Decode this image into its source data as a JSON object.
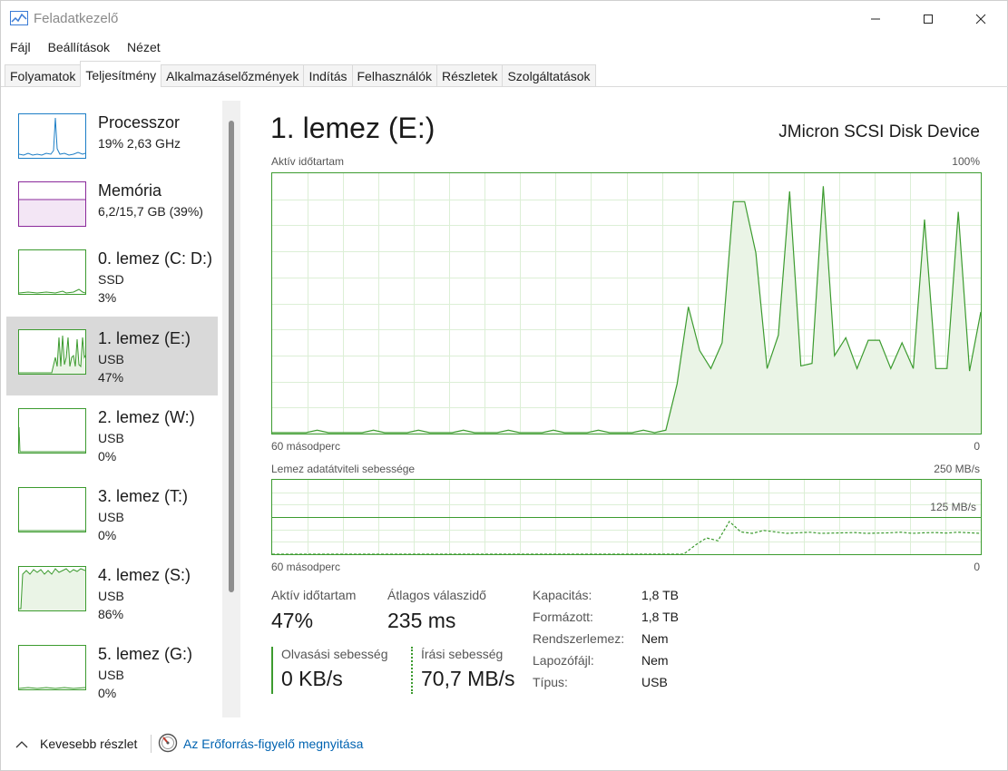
{
  "window": {
    "title": "Feladatkezelő"
  },
  "menu": {
    "items": [
      "Fájl",
      "Beállítások",
      "Nézet"
    ]
  },
  "tabs": [
    "Folyamatok",
    "Teljesítmény",
    "Alkalmazáselőzmények",
    "Indítás",
    "Felhasználók",
    "Részletek",
    "Szolgáltatások"
  ],
  "active_tab": "Teljesítmény",
  "sidebar": {
    "items": [
      {
        "name": "Processzor",
        "line1": "19% 2,63 GHz",
        "line2": ""
      },
      {
        "name": "Memória",
        "line1": "6,2/15,7 GB (39%)",
        "line2": ""
      },
      {
        "name": "0. lemez (C: D:)",
        "line1": "SSD",
        "line2": "3%"
      },
      {
        "name": "1. lemez (E:)",
        "line1": "USB",
        "line2": "47%"
      },
      {
        "name": "2. lemez (W:)",
        "line1": "USB",
        "line2": "0%"
      },
      {
        "name": "3. lemez (T:)",
        "line1": "USB",
        "line2": "0%"
      },
      {
        "name": "4. lemez (S:)",
        "line1": "USB",
        "line2": "86%"
      },
      {
        "name": "5. lemez (G:)",
        "line1": "USB",
        "line2": "0%"
      }
    ],
    "selected": "1. lemez (E:)"
  },
  "main": {
    "title": "1. lemez (E:)",
    "device": "JMicron  SCSI Disk Device",
    "chart1": {
      "label": "Aktív időtartam",
      "max_label": "100%",
      "time_label": "60 másodperc",
      "min_label": "0"
    },
    "chart2": {
      "label": "Lemez adatátviteli sebessége",
      "max_label": "250 MB/s",
      "mid_label": "125 MB/s",
      "time_label": "60 másodperc",
      "min_label": "0"
    },
    "stats": {
      "active_label": "Aktív időtartam",
      "active_value": "47%",
      "response_label": "Átlagos válaszidő",
      "response_value": "235 ms",
      "read_label": "Olvasási sebesség",
      "read_value": "0 KB/s",
      "write_label": "Írási sebesség",
      "write_value": "70,7 MB/s"
    },
    "properties": [
      {
        "label": "Kapacitás:",
        "value": "1,8 TB"
      },
      {
        "label": "Formázott:",
        "value": "1,8 TB"
      },
      {
        "label": "Rendszerlemez:",
        "value": "Nem"
      },
      {
        "label": "Lapozófájl:",
        "value": "Nem"
      },
      {
        "label": "Típus:",
        "value": "USB"
      }
    ]
  },
  "footer": {
    "less_details": "Kevesebb részlet",
    "resource_monitor": "Az Erőforrás-figyelő megnyitása"
  },
  "colors": {
    "disk": "#3c9b2f",
    "disk_fill": "#eaf4e6",
    "cpu": "#1c7ec6",
    "memory": "#8b2a9b",
    "link": "#0063b1"
  },
  "chart_data": [
    {
      "type": "area",
      "title": "Aktív időtartam",
      "xlabel": "60 másodperc",
      "ylabel": "",
      "ylim": [
        0,
        100
      ],
      "x": [
        0,
        1,
        2,
        3,
        4,
        5,
        6,
        7,
        8,
        9,
        10,
        11,
        12,
        13,
        14,
        15,
        16,
        17,
        18,
        19,
        20,
        21,
        22,
        23,
        24,
        25,
        26,
        27,
        28,
        29,
        30,
        31,
        32,
        33,
        34,
        35,
        36,
        37,
        38,
        39,
        40,
        41,
        42,
        43,
        44,
        45,
        46,
        47,
        48,
        49,
        50,
        51,
        52,
        53,
        54,
        55,
        56,
        57,
        58,
        59,
        60
      ],
      "values": [
        0,
        0,
        0,
        0,
        1,
        0,
        0,
        0,
        0,
        1,
        0,
        0,
        0,
        1,
        0,
        0,
        0,
        1,
        0,
        0,
        0,
        1,
        0,
        0,
        0,
        1,
        0,
        0,
        0,
        1,
        0,
        0,
        0,
        1,
        0,
        1,
        19,
        49,
        32,
        25,
        35,
        90,
        90,
        70,
        25,
        38,
        94,
        26,
        27,
        96,
        30,
        37,
        25,
        36,
        36,
        25,
        35,
        25,
        83,
        25,
        25,
        86,
        24,
        47
      ],
      "grid": true
    },
    {
      "type": "line",
      "title": "Lemez adatátviteli sebessége",
      "xlabel": "60 másodperc",
      "ylabel": "",
      "ylim": [
        0,
        250
      ],
      "annotations": [
        "125 MB/s"
      ],
      "series": [
        {
          "values": [
            0,
            0,
            0,
            0,
            0,
            0,
            0,
            0,
            0,
            0,
            0,
            0,
            0,
            0,
            0,
            0,
            0,
            0,
            0,
            0,
            0,
            0,
            0,
            0,
            0,
            0,
            0,
            0,
            0,
            0,
            0,
            0,
            0,
            0,
            0,
            0,
            0,
            30,
            55,
            45,
            110,
            75,
            70,
            80,
            75,
            70,
            72,
            74,
            70,
            71,
            72,
            73,
            70,
            71,
            72,
            74,
            70,
            72,
            73,
            71,
            74,
            72,
            70
          ]
        }
      ],
      "grid": true
    }
  ]
}
